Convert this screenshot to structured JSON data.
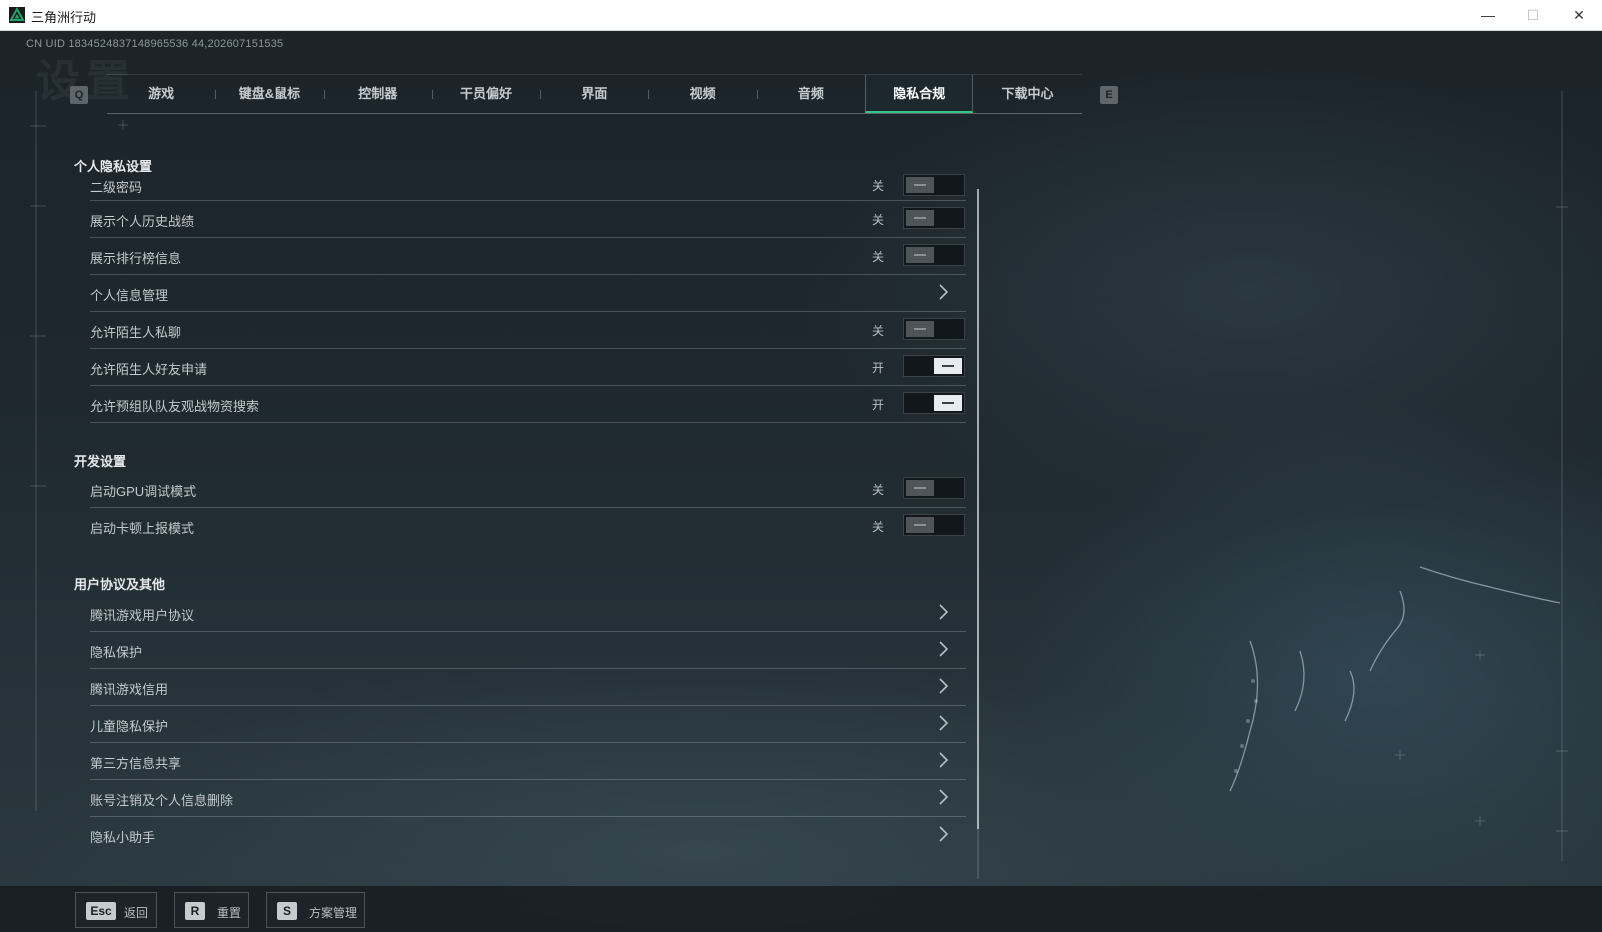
{
  "window": {
    "title": "三角洲行动",
    "minimize_glyph": "—",
    "maximize_glyph": "☐",
    "close_glyph": "✕"
  },
  "uid": "CN UID 1834524837148965536 44,202607151535",
  "ghost_title": "设置",
  "tabs": {
    "prev_key": "Q",
    "next_key": "E",
    "items": [
      {
        "label": "游戏"
      },
      {
        "label": "键盘&鼠标"
      },
      {
        "label": "控制器"
      },
      {
        "label": "干员偏好"
      },
      {
        "label": "界面"
      },
      {
        "label": "视频"
      },
      {
        "label": "音频"
      },
      {
        "label": "隐私合规"
      },
      {
        "label": "下载中心"
      }
    ],
    "active_index": 7
  },
  "sections": {
    "privacy": {
      "title": "个人隐私设置",
      "rows": [
        {
          "label": "二级密码",
          "state": "关",
          "on": false
        },
        {
          "label": "展示个人历史战绩",
          "state": "关",
          "on": false
        },
        {
          "label": "展示排行榜信息",
          "state": "关",
          "on": false
        },
        {
          "label": "个人信息管理"
        },
        {
          "label": "允许陌生人私聊",
          "state": "关",
          "on": false
        },
        {
          "label": "允许陌生人好友申请",
          "state": "开",
          "on": true
        },
        {
          "label": "允许预组队队友观战物资搜索",
          "state": "开",
          "on": true
        }
      ]
    },
    "dev": {
      "title": "开发设置",
      "rows": [
        {
          "label": "启动GPU调试模式",
          "state": "关",
          "on": false
        },
        {
          "label": "启动卡顿上报模式",
          "state": "关",
          "on": false
        }
      ]
    },
    "agreements": {
      "title": "用户协议及其他",
      "rows": [
        {
          "label": "腾讯游戏用户协议"
        },
        {
          "label": "隐私保护"
        },
        {
          "label": "腾讯游戏信用"
        },
        {
          "label": "儿童隐私保护"
        },
        {
          "label": "第三方信息共享"
        },
        {
          "label": "账号注销及个人信息删除"
        },
        {
          "label": "隐私小助手"
        }
      ]
    }
  },
  "bottom_bar": {
    "back": {
      "key": "Esc",
      "label": "返回"
    },
    "reset": {
      "key": "R",
      "label": "重置"
    },
    "scheme": {
      "key": "S",
      "label": "方案管理"
    }
  },
  "colors": {
    "accent": "#2ec98b",
    "background": "#1c242a",
    "app_icon": "#1fa46a"
  },
  "icons": {
    "app": "triangle-logo-icon",
    "row_chevron": "chevron-right-icon"
  }
}
